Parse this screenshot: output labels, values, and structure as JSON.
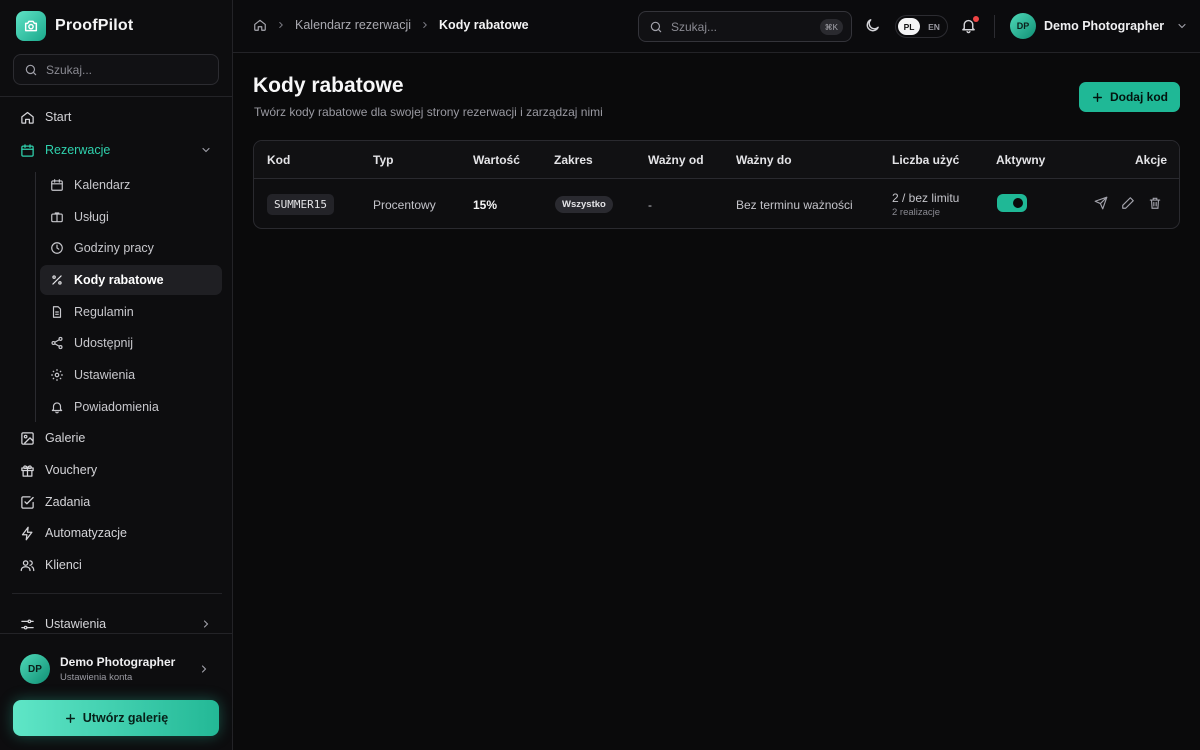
{
  "app": {
    "name": "ProofPilot"
  },
  "sidebar": {
    "search_placeholder": "Szukaj...",
    "items": [
      {
        "label": "Start",
        "icon": "home-icon"
      },
      {
        "label": "Rezerwacje",
        "icon": "calendar-icon",
        "expanded": true
      },
      {
        "label": "Galerie",
        "icon": "image-icon"
      },
      {
        "label": "Vouchery",
        "icon": "gift-icon"
      },
      {
        "label": "Zadania",
        "icon": "checkbox-icon"
      },
      {
        "label": "Automatyzacje",
        "icon": "zap-icon"
      },
      {
        "label": "Klienci",
        "icon": "users-icon"
      }
    ],
    "sub_items": [
      {
        "label": "Kalendarz",
        "icon": "calendar-icon"
      },
      {
        "label": "Usługi",
        "icon": "briefcase-icon"
      },
      {
        "label": "Godziny pracy",
        "icon": "clock-icon"
      },
      {
        "label": "Kody rabatowe",
        "icon": "percent-icon",
        "active": true
      },
      {
        "label": "Regulamin",
        "icon": "document-icon"
      },
      {
        "label": "Udostępnij",
        "icon": "share-icon"
      },
      {
        "label": "Ustawienia",
        "icon": "gear-icon"
      },
      {
        "label": "Powiadomienia",
        "icon": "bell-icon"
      }
    ],
    "settings_label": "Ustawienia",
    "user": {
      "initials": "DP",
      "name": "Demo Photographer",
      "subtitle": "Ustawienia konta"
    },
    "create_button": "Utwórz galerię"
  },
  "topbar": {
    "breadcrumb": [
      "Kalendarz rezerwacji",
      "Kody rabatowe"
    ],
    "search_placeholder": "Szukaj...",
    "shortcut": "⌘K",
    "languages": [
      "PL",
      "EN"
    ],
    "active_language": "PL",
    "user": {
      "initials": "DP",
      "name": "Demo Photographer"
    }
  },
  "page": {
    "title": "Kody rabatowe",
    "subtitle": "Twórz kody rabatowe dla swojej strony rezerwacji i zarządzaj nimi",
    "add_button": "Dodaj kod"
  },
  "table": {
    "columns": [
      "Kod",
      "Typ",
      "Wartość",
      "Zakres",
      "Ważny od",
      "Ważny do",
      "Liczba użyć",
      "Aktywny",
      "Akcje"
    ],
    "rows": [
      {
        "code": "SUMMER15",
        "type": "Procentowy",
        "value": "15%",
        "scope": "Wszystko",
        "valid_from": "-",
        "valid_to": "Bez terminu ważności",
        "uses": "2 / bez limitu",
        "uses_sub": "2 realizacje",
        "active": true
      }
    ]
  },
  "colors": {
    "accent": "#1fb896",
    "background": "#0a0a0b"
  }
}
